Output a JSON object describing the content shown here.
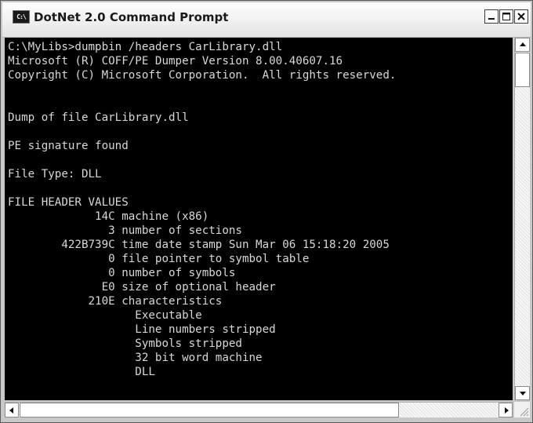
{
  "window": {
    "title": "DotNet 2.0 Command Prompt",
    "icon": "console-icon",
    "icon_text": "C:\\"
  },
  "console": {
    "lines": [
      "C:\\MyLibs>dumpbin /headers CarLibrary.dll",
      "Microsoft (R) COFF/PE Dumper Version 8.00.40607.16",
      "Copyright (C) Microsoft Corporation.  All rights reserved.",
      "",
      "",
      "Dump of file CarLibrary.dll",
      "",
      "PE signature found",
      "",
      "File Type: DLL",
      "",
      "FILE HEADER VALUES",
      "             14C machine (x86)",
      "               3 number of sections",
      "        422B739C time date stamp Sun Mar 06 15:18:20 2005",
      "               0 file pointer to symbol table",
      "               0 number of symbols",
      "              E0 size of optional header",
      "            210E characteristics",
      "                   Executable",
      "                   Line numbers stripped",
      "                   Symbols stripped",
      "                   32 bit word machine",
      "                   DLL"
    ]
  },
  "colors": {
    "console_bg": "#000000",
    "console_text": "#d8d8d8"
  }
}
